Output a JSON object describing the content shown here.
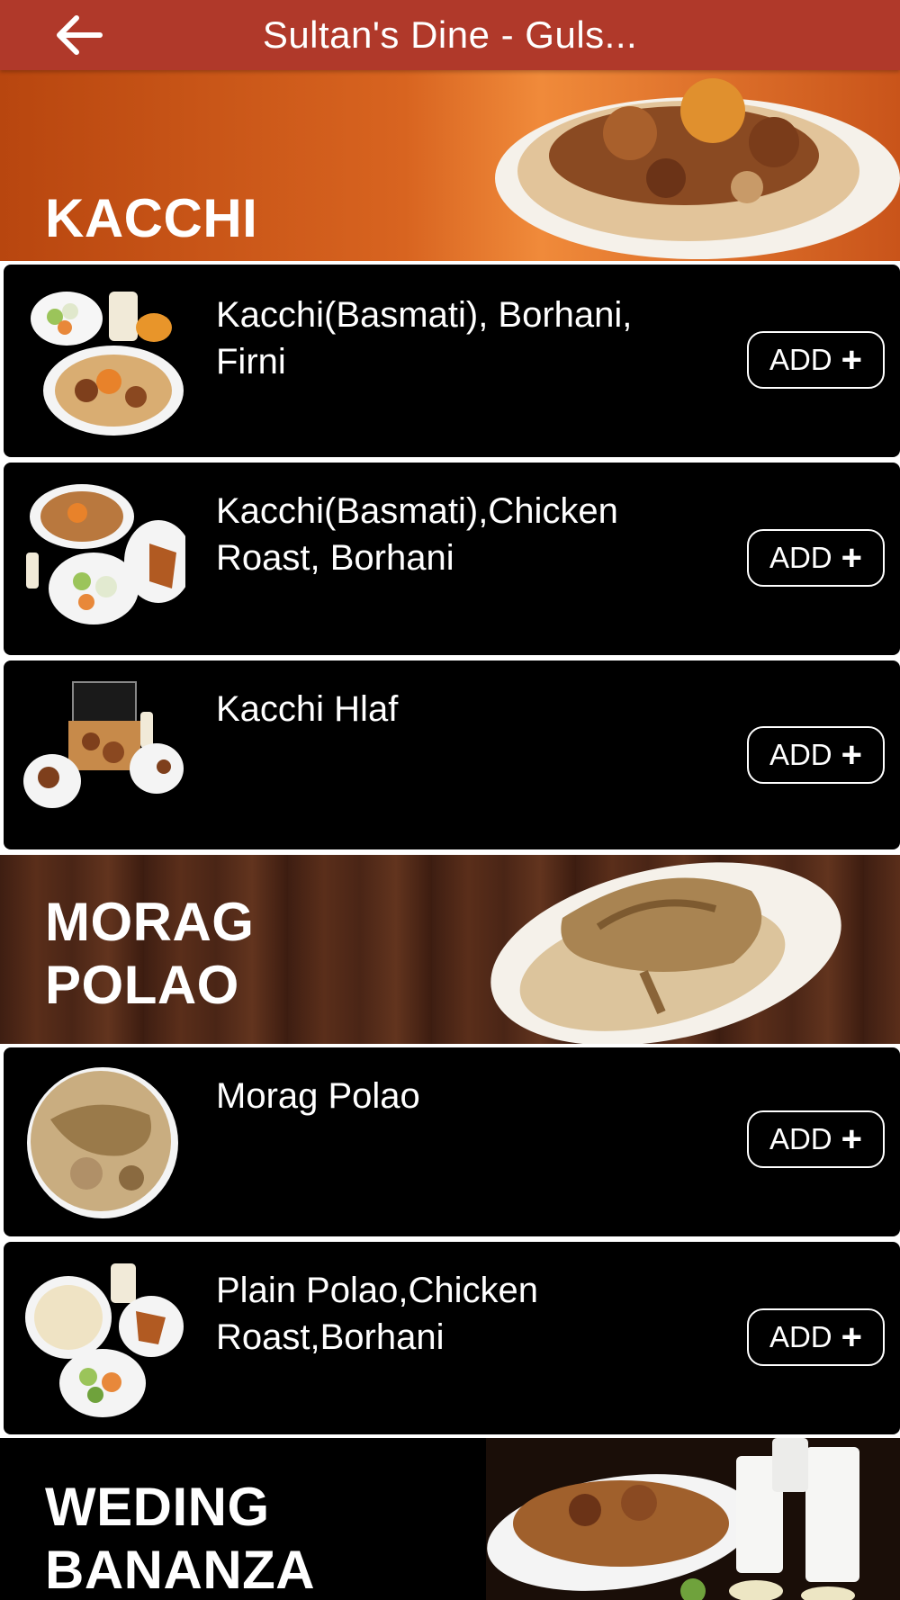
{
  "header": {
    "title": "Sultan's Dine - Guls...",
    "back_icon": "arrow-left-icon"
  },
  "sections": [
    {
      "title_line1": "KACCHI",
      "items": [
        {
          "name_line1": "Kacchi(Basmati), Borhani,",
          "name_line2": "Firni",
          "add_label": "ADD",
          "add_icon": "+"
        },
        {
          "name_line1": "Kacchi(Basmati),Chicken",
          "name_line2": "Roast, Borhani",
          "add_label": "ADD",
          "add_icon": "+"
        },
        {
          "name_line1": "Kacchi Hlaf",
          "name_line2": "",
          "add_label": "ADD",
          "add_icon": "+"
        }
      ]
    },
    {
      "title_line1": "MORAG",
      "title_line2": "POLAO",
      "items": [
        {
          "name_line1": "Morag Polao",
          "name_line2": "",
          "add_label": "ADD",
          "add_icon": "+"
        },
        {
          "name_line1": "Plain Polao,Chicken",
          "name_line2": "Roast,Borhani",
          "add_label": "ADD",
          "add_icon": "+"
        }
      ]
    },
    {
      "title_line1": "WEDING",
      "title_line2": "BANANZA",
      "items": []
    }
  ],
  "colors": {
    "header_bg": "#b0392a",
    "item_bg": "#000000",
    "kacchi_banner": "#c9541a",
    "morag_banner": "#4a2516",
    "weding_banner": "#000000"
  }
}
